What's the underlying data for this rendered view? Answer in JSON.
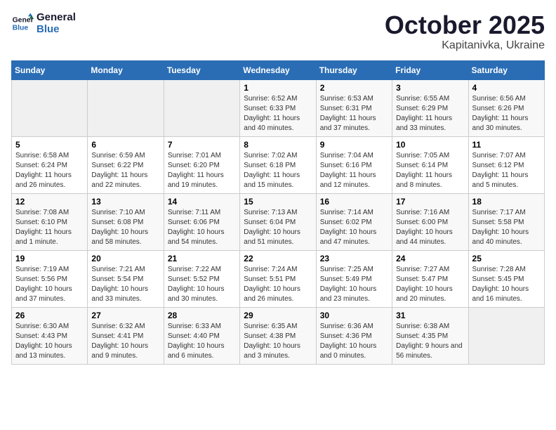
{
  "logo": {
    "line1": "General",
    "line2": "Blue"
  },
  "title": "October 2025",
  "subtitle": "Kapitanivka, Ukraine",
  "days_of_week": [
    "Sunday",
    "Monday",
    "Tuesday",
    "Wednesday",
    "Thursday",
    "Friday",
    "Saturday"
  ],
  "weeks": [
    [
      {
        "day": "",
        "sunrise": "",
        "sunset": "",
        "daylight": ""
      },
      {
        "day": "",
        "sunrise": "",
        "sunset": "",
        "daylight": ""
      },
      {
        "day": "",
        "sunrise": "",
        "sunset": "",
        "daylight": ""
      },
      {
        "day": "1",
        "sunrise": "Sunrise: 6:52 AM",
        "sunset": "Sunset: 6:33 PM",
        "daylight": "Daylight: 11 hours and 40 minutes."
      },
      {
        "day": "2",
        "sunrise": "Sunrise: 6:53 AM",
        "sunset": "Sunset: 6:31 PM",
        "daylight": "Daylight: 11 hours and 37 minutes."
      },
      {
        "day": "3",
        "sunrise": "Sunrise: 6:55 AM",
        "sunset": "Sunset: 6:29 PM",
        "daylight": "Daylight: 11 hours and 33 minutes."
      },
      {
        "day": "4",
        "sunrise": "Sunrise: 6:56 AM",
        "sunset": "Sunset: 6:26 PM",
        "daylight": "Daylight: 11 hours and 30 minutes."
      }
    ],
    [
      {
        "day": "5",
        "sunrise": "Sunrise: 6:58 AM",
        "sunset": "Sunset: 6:24 PM",
        "daylight": "Daylight: 11 hours and 26 minutes."
      },
      {
        "day": "6",
        "sunrise": "Sunrise: 6:59 AM",
        "sunset": "Sunset: 6:22 PM",
        "daylight": "Daylight: 11 hours and 22 minutes."
      },
      {
        "day": "7",
        "sunrise": "Sunrise: 7:01 AM",
        "sunset": "Sunset: 6:20 PM",
        "daylight": "Daylight: 11 hours and 19 minutes."
      },
      {
        "day": "8",
        "sunrise": "Sunrise: 7:02 AM",
        "sunset": "Sunset: 6:18 PM",
        "daylight": "Daylight: 11 hours and 15 minutes."
      },
      {
        "day": "9",
        "sunrise": "Sunrise: 7:04 AM",
        "sunset": "Sunset: 6:16 PM",
        "daylight": "Daylight: 11 hours and 12 minutes."
      },
      {
        "day": "10",
        "sunrise": "Sunrise: 7:05 AM",
        "sunset": "Sunset: 6:14 PM",
        "daylight": "Daylight: 11 hours and 8 minutes."
      },
      {
        "day": "11",
        "sunrise": "Sunrise: 7:07 AM",
        "sunset": "Sunset: 6:12 PM",
        "daylight": "Daylight: 11 hours and 5 minutes."
      }
    ],
    [
      {
        "day": "12",
        "sunrise": "Sunrise: 7:08 AM",
        "sunset": "Sunset: 6:10 PM",
        "daylight": "Daylight: 11 hours and 1 minute."
      },
      {
        "day": "13",
        "sunrise": "Sunrise: 7:10 AM",
        "sunset": "Sunset: 6:08 PM",
        "daylight": "Daylight: 10 hours and 58 minutes."
      },
      {
        "day": "14",
        "sunrise": "Sunrise: 7:11 AM",
        "sunset": "Sunset: 6:06 PM",
        "daylight": "Daylight: 10 hours and 54 minutes."
      },
      {
        "day": "15",
        "sunrise": "Sunrise: 7:13 AM",
        "sunset": "Sunset: 6:04 PM",
        "daylight": "Daylight: 10 hours and 51 minutes."
      },
      {
        "day": "16",
        "sunrise": "Sunrise: 7:14 AM",
        "sunset": "Sunset: 6:02 PM",
        "daylight": "Daylight: 10 hours and 47 minutes."
      },
      {
        "day": "17",
        "sunrise": "Sunrise: 7:16 AM",
        "sunset": "Sunset: 6:00 PM",
        "daylight": "Daylight: 10 hours and 44 minutes."
      },
      {
        "day": "18",
        "sunrise": "Sunrise: 7:17 AM",
        "sunset": "Sunset: 5:58 PM",
        "daylight": "Daylight: 10 hours and 40 minutes."
      }
    ],
    [
      {
        "day": "19",
        "sunrise": "Sunrise: 7:19 AM",
        "sunset": "Sunset: 5:56 PM",
        "daylight": "Daylight: 10 hours and 37 minutes."
      },
      {
        "day": "20",
        "sunrise": "Sunrise: 7:21 AM",
        "sunset": "Sunset: 5:54 PM",
        "daylight": "Daylight: 10 hours and 33 minutes."
      },
      {
        "day": "21",
        "sunrise": "Sunrise: 7:22 AM",
        "sunset": "Sunset: 5:52 PM",
        "daylight": "Daylight: 10 hours and 30 minutes."
      },
      {
        "day": "22",
        "sunrise": "Sunrise: 7:24 AM",
        "sunset": "Sunset: 5:51 PM",
        "daylight": "Daylight: 10 hours and 26 minutes."
      },
      {
        "day": "23",
        "sunrise": "Sunrise: 7:25 AM",
        "sunset": "Sunset: 5:49 PM",
        "daylight": "Daylight: 10 hours and 23 minutes."
      },
      {
        "day": "24",
        "sunrise": "Sunrise: 7:27 AM",
        "sunset": "Sunset: 5:47 PM",
        "daylight": "Daylight: 10 hours and 20 minutes."
      },
      {
        "day": "25",
        "sunrise": "Sunrise: 7:28 AM",
        "sunset": "Sunset: 5:45 PM",
        "daylight": "Daylight: 10 hours and 16 minutes."
      }
    ],
    [
      {
        "day": "26",
        "sunrise": "Sunrise: 6:30 AM",
        "sunset": "Sunset: 4:43 PM",
        "daylight": "Daylight: 10 hours and 13 minutes."
      },
      {
        "day": "27",
        "sunrise": "Sunrise: 6:32 AM",
        "sunset": "Sunset: 4:41 PM",
        "daylight": "Daylight: 10 hours and 9 minutes."
      },
      {
        "day": "28",
        "sunrise": "Sunrise: 6:33 AM",
        "sunset": "Sunset: 4:40 PM",
        "daylight": "Daylight: 10 hours and 6 minutes."
      },
      {
        "day": "29",
        "sunrise": "Sunrise: 6:35 AM",
        "sunset": "Sunset: 4:38 PM",
        "daylight": "Daylight: 10 hours and 3 minutes."
      },
      {
        "day": "30",
        "sunrise": "Sunrise: 6:36 AM",
        "sunset": "Sunset: 4:36 PM",
        "daylight": "Daylight: 10 hours and 0 minutes."
      },
      {
        "day": "31",
        "sunrise": "Sunrise: 6:38 AM",
        "sunset": "Sunset: 4:35 PM",
        "daylight": "Daylight: 9 hours and 56 minutes."
      },
      {
        "day": "",
        "sunrise": "",
        "sunset": "",
        "daylight": ""
      }
    ]
  ]
}
